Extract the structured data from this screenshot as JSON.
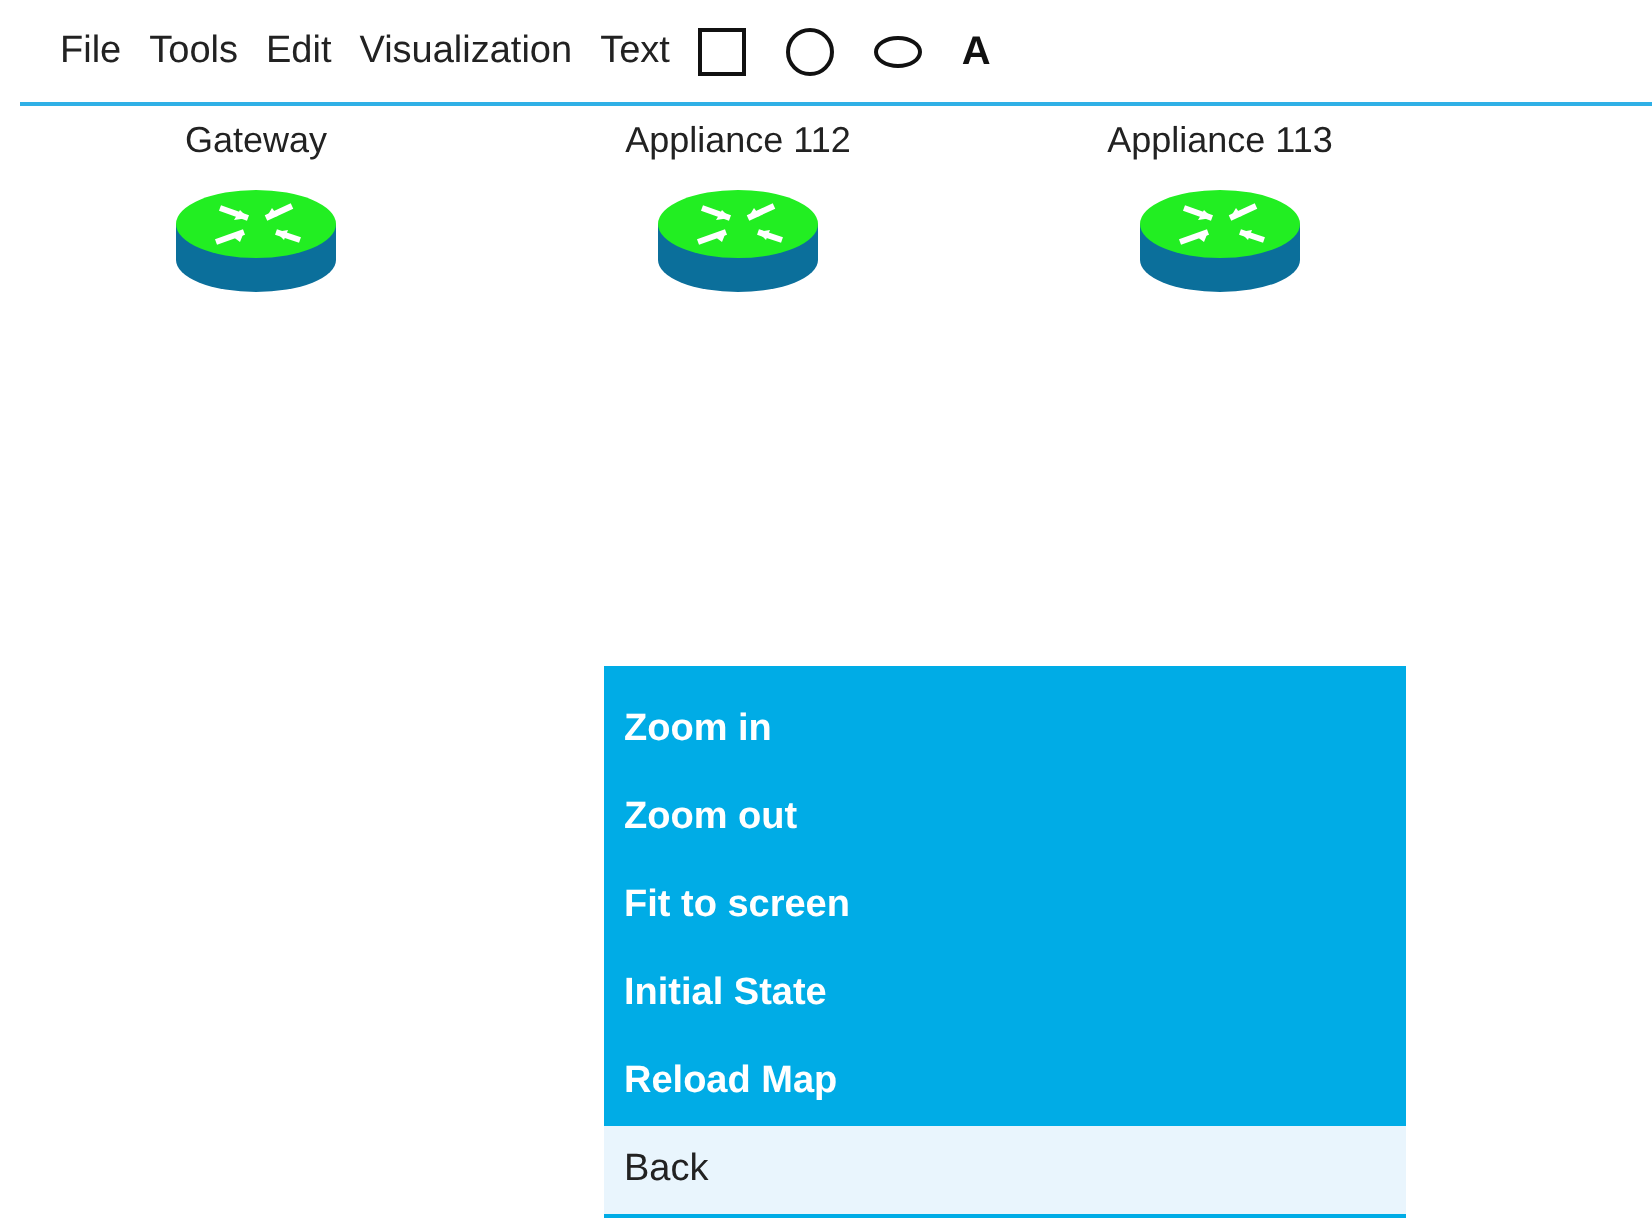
{
  "menu_bar": {
    "items": [
      "File",
      "Tools",
      "Edit",
      "Visualization",
      "Text"
    ],
    "tools": [
      {
        "kind": "rectangle"
      },
      {
        "kind": "circle"
      },
      {
        "kind": "ellipse"
      },
      {
        "kind": "text",
        "label": "A"
      }
    ]
  },
  "nodes": [
    {
      "label": "Gateway"
    },
    {
      "label": "Appliance 112"
    },
    {
      "label": "Appliance 113"
    }
  ],
  "context_menu": {
    "items": [
      {
        "label": "Zoom in",
        "selected": false
      },
      {
        "label": "Zoom out",
        "selected": false
      },
      {
        "label": "Fit to screen",
        "selected": false
      },
      {
        "label": "Initial State",
        "selected": false
      },
      {
        "label": "Reload Map",
        "selected": false
      },
      {
        "label": "Back",
        "selected": true
      }
    ]
  }
}
